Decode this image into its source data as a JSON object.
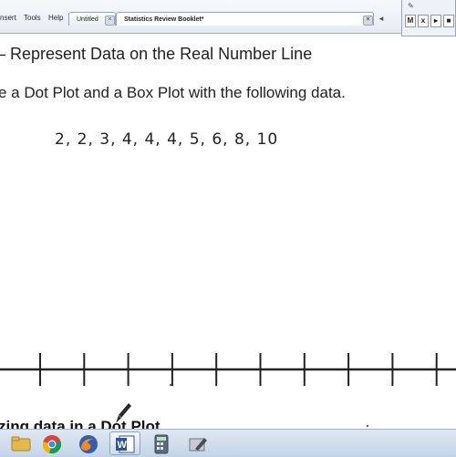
{
  "menu": {
    "items": [
      {
        "label": "nsert"
      },
      {
        "label": "Tools"
      },
      {
        "label": "Help"
      }
    ]
  },
  "tabs": [
    {
      "label": "Untitled",
      "active": false
    },
    {
      "label": "Statistics Review Booklet*",
      "active": true
    }
  ],
  "float_toolbar": {
    "buttons": [
      {
        "label": "M"
      },
      {
        "label": "x"
      },
      {
        "label": "▸"
      },
      {
        "label": "■"
      }
    ]
  },
  "document": {
    "heading": "– Represent Data on the Real Number Line",
    "instruction": "e a Dot Plot and a Box Plot with the following data.",
    "data_values": "2,  2,  3,  4,  4,  4,  5,  6,  8,  10",
    "section_heading": "zing data in a Dot Plot"
  },
  "number_line": {
    "ticks": 10
  },
  "taskbar": {
    "apps": [
      {
        "icon": "folder-icon"
      },
      {
        "icon": "chrome-icon"
      },
      {
        "icon": "firefox-icon"
      },
      {
        "icon": "word-icon"
      },
      {
        "icon": "calculator-icon"
      },
      {
        "icon": "pen-tablet-icon"
      }
    ]
  },
  "colors": {
    "ink": "#222222",
    "taskbar": "#c9d8ea",
    "word_blue": "#2b579a"
  }
}
